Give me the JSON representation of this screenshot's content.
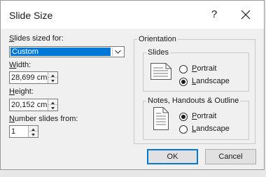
{
  "dialog": {
    "title": "Slide Size",
    "help_label": "?"
  },
  "slides_sized_for": {
    "label_prefix": "",
    "label_accel": "S",
    "label_rest": "lides sized for:",
    "value": "Custom"
  },
  "width": {
    "label_accel": "W",
    "label_rest": "idth:",
    "value": "28,699 cm"
  },
  "height": {
    "label_accel": "H",
    "label_rest": "eight:",
    "value": "20,152 cm"
  },
  "number_from": {
    "label_accel": "N",
    "label_rest": "umber slides from:",
    "value": "1"
  },
  "orientation": {
    "title": "Orientation",
    "slides": {
      "title": "Slides",
      "portrait_accel": "P",
      "portrait_rest": "ortrait",
      "landscape_accel": "L",
      "landscape_rest": "andscape",
      "selected": "landscape"
    },
    "notes": {
      "title": "Notes, Handouts & Outline",
      "portrait_accel": "P",
      "portrait_rest": "ortrait",
      "landscape_accel": "L",
      "landscape_rest": "andscape",
      "selected": "portrait"
    }
  },
  "buttons": {
    "ok": "OK",
    "cancel": "Cancel"
  }
}
